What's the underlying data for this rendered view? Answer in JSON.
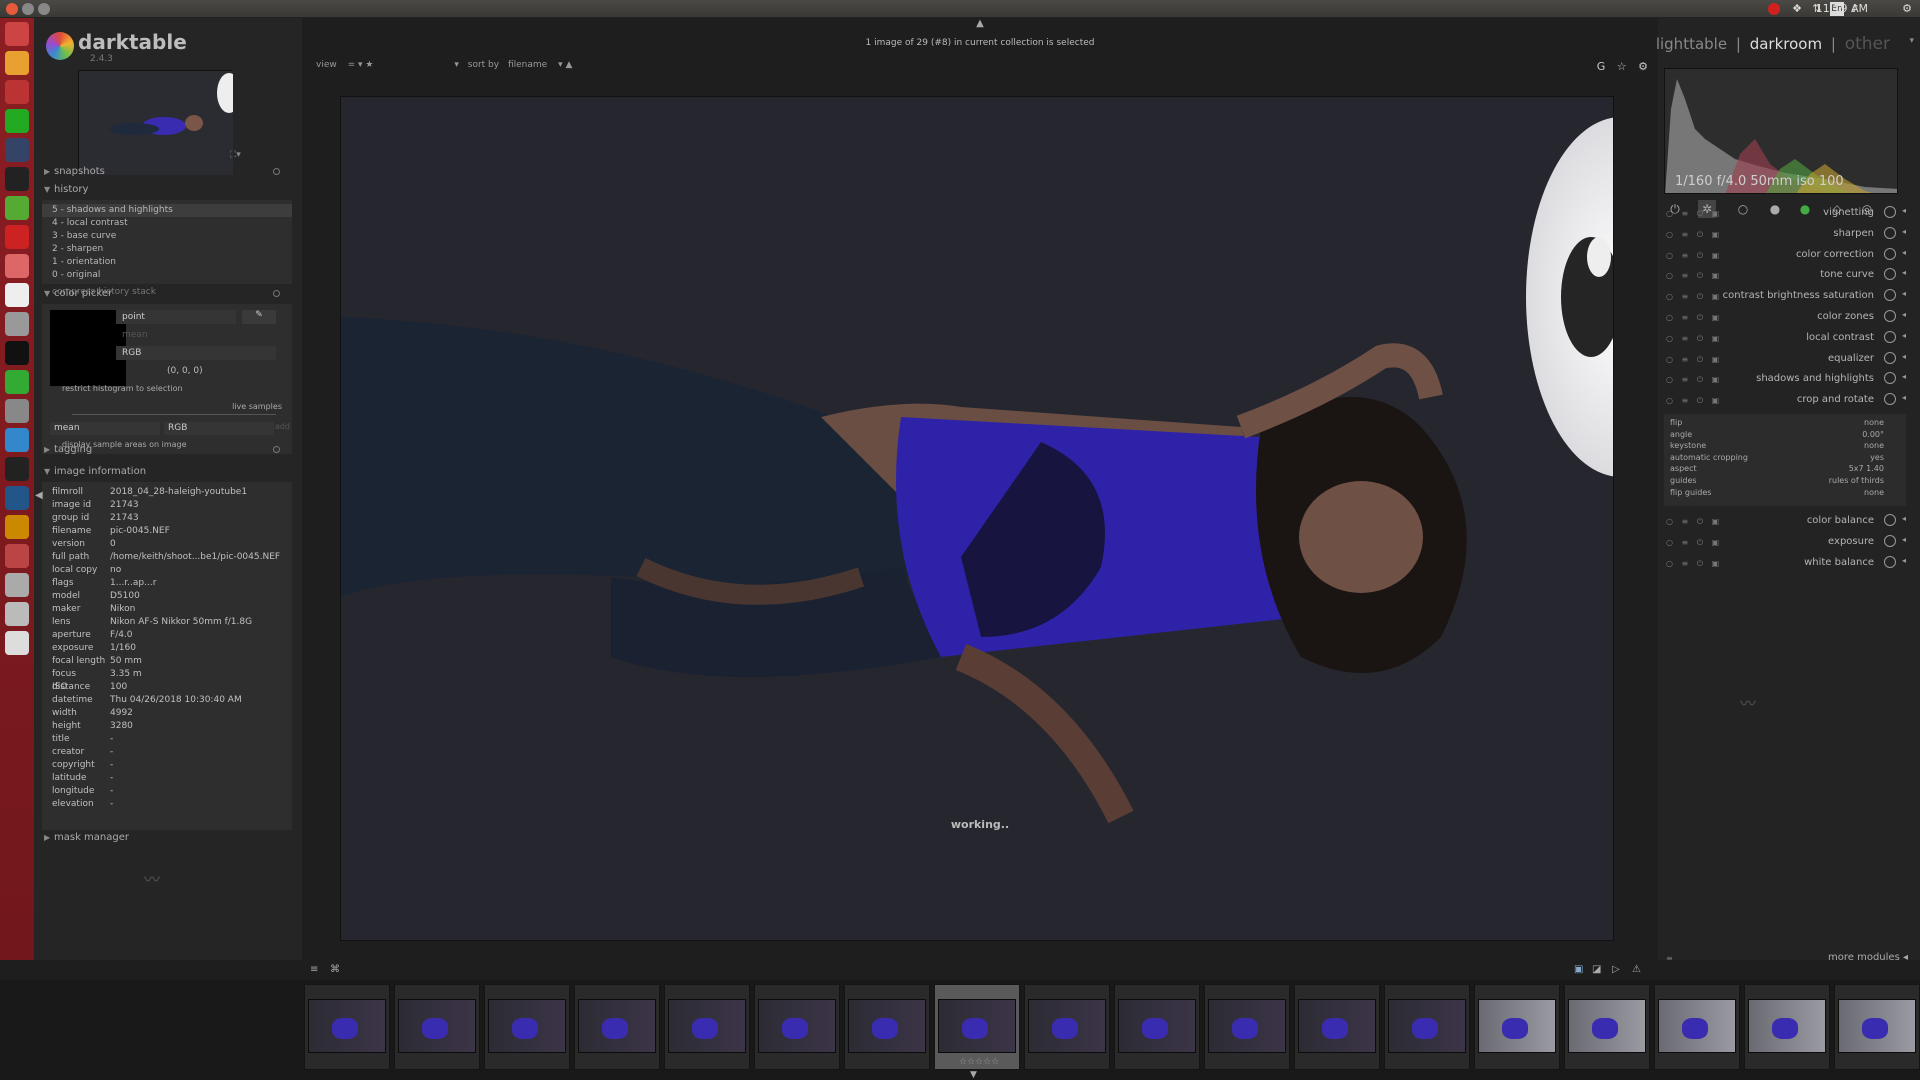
{
  "system": {
    "clock": "11:19 AM",
    "lang": "En"
  },
  "app": {
    "name": "darktable",
    "version": "2.4.3"
  },
  "left": {
    "snapshots": "snapshots",
    "history": {
      "title": "history",
      "items": [
        "5 - shadows and highlights",
        "4 - local contrast",
        "3 - base curve",
        "2 - sharpen",
        "1 - orientation",
        "0 - original"
      ],
      "compress": "compress history stack"
    },
    "color_picker": {
      "title": "color picker",
      "mode": "point",
      "stat": "mean",
      "space": "RGB",
      "value": "(0, 0, 0)",
      "restrict": "restrict histogram to selection",
      "live_samples": "live samples",
      "sample_stat": "mean",
      "sample_space": "RGB",
      "add": "add",
      "display_samples": "display sample areas on image"
    },
    "tagging": "tagging",
    "image_info": {
      "title": "image information",
      "rows": [
        [
          "filmroll",
          "2018_04_28-haleigh-youtube1"
        ],
        [
          "image id",
          "21743"
        ],
        [
          "group id",
          "21743"
        ],
        [
          "filename",
          "pic-0045.NEF"
        ],
        [
          "version",
          "0"
        ],
        [
          "full path",
          "/home/keith/shoot...be1/pic-0045.NEF"
        ],
        [
          "local copy",
          "no"
        ],
        [
          "flags",
          "1...r..ap...r"
        ],
        [
          "model",
          "D5100"
        ],
        [
          "maker",
          "Nikon"
        ],
        [
          "lens",
          "Nikon AF-S Nikkor 50mm f/1.8G"
        ],
        [
          "aperture",
          "F/4.0"
        ],
        [
          "exposure",
          "1/160"
        ],
        [
          "focal length",
          "50 mm"
        ],
        [
          "focus distance",
          "3.35 m"
        ],
        [
          "ISO",
          "100"
        ],
        [
          "datetime",
          "Thu 04/26/2018 10:30:40 AM"
        ],
        [
          "width",
          "4992"
        ],
        [
          "height",
          "3280"
        ],
        [
          "title",
          "-"
        ],
        [
          "creator",
          "-"
        ],
        [
          "copyright",
          "-"
        ],
        [
          "latitude",
          "-"
        ],
        [
          "longitude",
          "-"
        ],
        [
          "elevation",
          "-"
        ]
      ]
    },
    "mask_manager": "mask manager"
  },
  "center": {
    "status": "1 image of 29 (#8) in current collection is selected",
    "view_label": "view",
    "sort_label": "sort by",
    "sort_value": "filename",
    "working": "working.."
  },
  "right": {
    "views": {
      "lighttable": "lighttable",
      "darkroom": "darkroom",
      "other": "other",
      "sep": "|"
    },
    "exif": "1/160 f/4.0 50mm iso 100",
    "modules": [
      "vignetting",
      "sharpen",
      "color correction",
      "tone curve",
      "contrast brightness saturation",
      "color zones",
      "local contrast",
      "equalizer",
      "shadows and highlights",
      "crop and rotate"
    ],
    "crop": {
      "rows": [
        [
          "flip",
          "none"
        ],
        [
          "angle",
          "0.00°"
        ],
        [
          "keystone",
          "none"
        ],
        [
          "automatic cropping",
          "yes"
        ],
        [
          "aspect",
          "5x7  1.40"
        ],
        [
          "guides",
          "rules of thirds"
        ],
        [
          "flip guides",
          "none"
        ]
      ]
    },
    "modules2": [
      "color balance",
      "exposure",
      "white balance"
    ],
    "more_modules": "more modules"
  },
  "filmstrip": {
    "count": 18,
    "selected_index": 7,
    "stars": "☆☆☆☆☆"
  },
  "colors": {
    "accent_red": "#8b1e23",
    "panel": "#252525",
    "photo_top": "#5020b0"
  }
}
